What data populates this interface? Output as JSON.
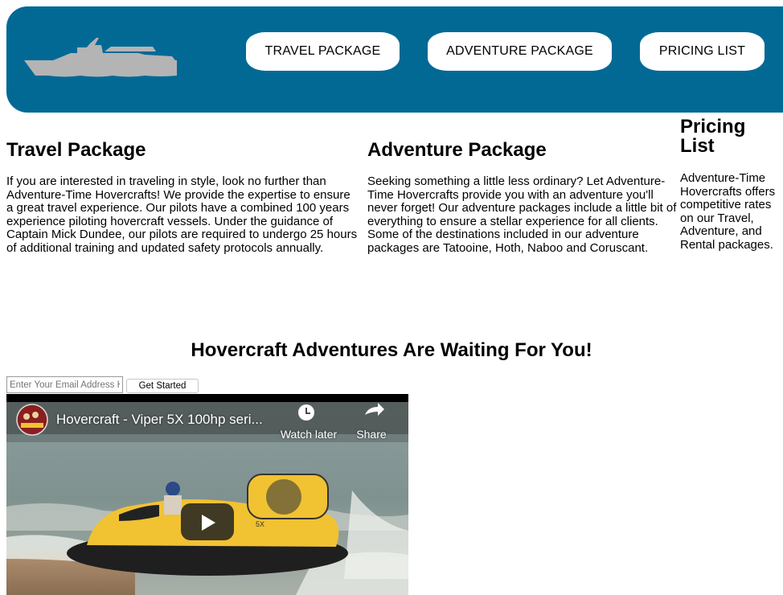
{
  "nav": {
    "items": [
      {
        "label": "TRAVEL PACKAGE"
      },
      {
        "label": "ADVENTURE PACKAGE"
      },
      {
        "label": "PRICING LIST"
      }
    ]
  },
  "sections": {
    "travel": {
      "title": "Travel Package",
      "text": "If you are interested in traveling in style, look no further than Adventure-Time Hovercrafts! We provide the expertise to ensure a great travel experience. Our pilots have a combined 100 years experience piloting hovercraft vessels. Under the guidance of Captain Mick Dundee, our pilots are required to undergo 25 hours of additional training and updated safety protocols annually."
    },
    "adventure": {
      "title": "Adventure Package",
      "text": "Seeking something a little less ordinary? Let Adventure-Time Hovercrafts provide you with an adventure you'll never forget! Our adventure packages include a little bit of everything to ensure a stellar experience for all clients. Some of the destinations included in our adventure packages are Tatooine, Hoth, Naboo and Coruscant."
    },
    "pricing": {
      "title": "Pricing List",
      "text": "Adventure-Time Hovercrafts offers competitive rates on our Travel, Adventure, and Rental packages."
    }
  },
  "hero": {
    "title": "Hovercraft Adventures Are Waiting For You!"
  },
  "signup": {
    "placeholder": "Enter Your Email Address Here",
    "button_label": "Get Started"
  },
  "video": {
    "title": "Hovercraft - Viper 5X 100hp seri...",
    "watch_later": "Watch later",
    "share": "Share"
  },
  "colors": {
    "header_bg": "#026995",
    "logo": "#b4b4b4",
    "hovercraft": "#f1c232"
  },
  "icons": {
    "logo": "ship-icon",
    "watch_later": "clock-icon",
    "share": "share-arrow-icon",
    "play": "play-icon"
  }
}
